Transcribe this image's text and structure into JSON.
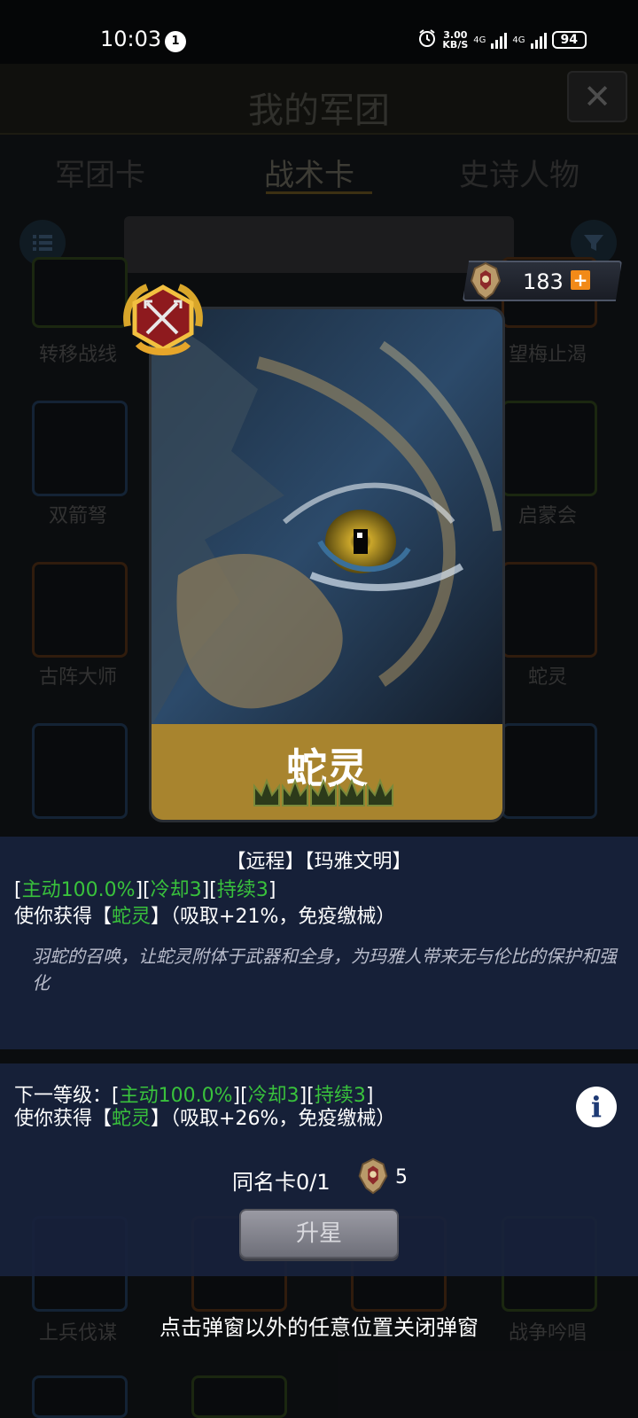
{
  "status_bar": {
    "time": "10:03",
    "notification_count": "1",
    "net_speed_top": "3.00",
    "net_speed_unit": "KB/S",
    "net1": "4G",
    "net2": "4G",
    "battery": "94"
  },
  "background": {
    "title": "我的军团",
    "tabs": [
      "军团卡",
      "战术卡",
      "史诗人物"
    ],
    "active_tab": "战术卡",
    "cards": [
      {
        "label": "转移战线"
      },
      {
        "label": "望梅止渴"
      },
      {
        "label": "双箭弩"
      },
      {
        "label": "启蒙会"
      },
      {
        "label": "古阵大师"
      },
      {
        "label": "蛇灵"
      },
      {
        "label": "上兵伐谋"
      },
      {
        "label": "战争吟唱"
      }
    ]
  },
  "currency": {
    "value": "183",
    "plus": "+"
  },
  "card": {
    "name": "蛇灵",
    "crowns": 5
  },
  "description": {
    "tags": "【远程】【玛雅文明】",
    "line1": {
      "b1": "[",
      "active": "主动100.0%",
      "b2": "][",
      "cooldown": "冷却3",
      "b3": "][",
      "duration": "持续3",
      "b4": "]"
    },
    "line2": {
      "prefix": "使你获得【",
      "buff": "蛇灵",
      "suffix": "】（吸取+21%，免疫缴械）"
    },
    "flavor": "羽蛇的召唤，让蛇灵附体于武器和全身，为玛雅人带来无与伦比的保护和强化"
  },
  "next_level": {
    "line1": {
      "prefix": "下一等级：[",
      "active": "主动100.0%",
      "b2": "][",
      "cooldown": "冷却3",
      "b3": "][",
      "duration": "持续3",
      "b4": "]"
    },
    "line2": {
      "prefix": "使你获得【",
      "buff": "蛇灵",
      "suffix": "】（吸取+26%，免疫缴械）"
    },
    "info_label": "i"
  },
  "upgrade": {
    "dup_label": "同名卡0/1",
    "cost": "5",
    "button": "升星"
  },
  "close_hint": "点击弹窗以外的任意位置关闭弹窗",
  "colors": {
    "accent_green": "#39c23c",
    "banner_gold": "#a8842e",
    "panel_blue": "#18223c",
    "plus_orange": "#f28a18"
  }
}
